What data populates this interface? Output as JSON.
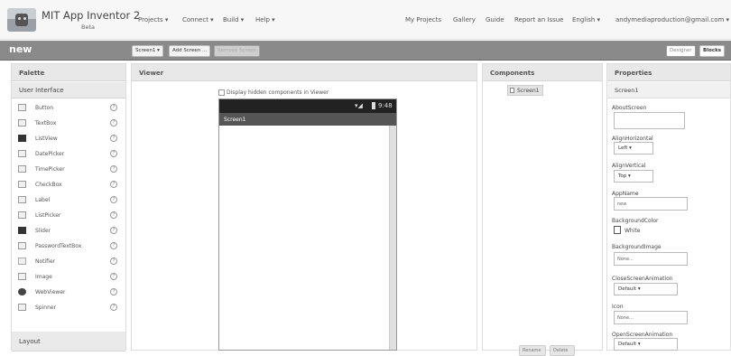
{
  "app": {
    "title": "MIT App Inventor 2",
    "badge": "Beta"
  },
  "nav": {
    "projects": "Projects ▾",
    "connect": "Connect ▾",
    "build": "Build ▾",
    "help": "Help ▾",
    "my_projects": "My Projects",
    "gallery": "Gallery",
    "guide": "Guide",
    "report": "Report an Issue",
    "language": "English ▾",
    "account": "andymediaproduction@gmail.com ▾"
  },
  "project_bar": {
    "name": "new",
    "screen_select": "Screen1 ▾",
    "add_screen": "Add Screen ...",
    "remove_screen": "Remove Screen",
    "designer": "Designer",
    "blocks": "Blocks"
  },
  "palette": {
    "title": "Palette",
    "category": "User Interface",
    "items": [
      {
        "label": "Button",
        "icon": "button-icon"
      },
      {
        "label": "TextBox",
        "icon": "textbox-icon"
      },
      {
        "label": "ListView",
        "icon": "listview-icon"
      },
      {
        "label": "DatePicker",
        "icon": "datepicker-icon"
      },
      {
        "label": "TimePicker",
        "icon": "timepicker-icon"
      },
      {
        "label": "CheckBox",
        "icon": "checkbox-icon"
      },
      {
        "label": "Label",
        "icon": "label-icon"
      },
      {
        "label": "ListPicker",
        "icon": "listpicker-icon"
      },
      {
        "label": "Slider",
        "icon": "slider-icon"
      },
      {
        "label": "PasswordTextBox",
        "icon": "password-icon"
      },
      {
        "label": "Notifier",
        "icon": "notifier-icon"
      },
      {
        "label": "Image",
        "icon": "image-icon"
      },
      {
        "label": "WebViewer",
        "icon": "webviewer-icon"
      },
      {
        "label": "Spinner",
        "icon": "spinner-icon"
      }
    ],
    "help_glyph": "?",
    "layout_category": "Layout"
  },
  "viewer": {
    "title": "Viewer",
    "hidden_checkbox": "Display hidden components in Viewer",
    "time": "9:48",
    "screen_title": "Screen1"
  },
  "components": {
    "title": "Components",
    "root": "Screen1",
    "rename": "Rename",
    "delete": "Delete"
  },
  "properties": {
    "title": "Properties",
    "component": "Screen1",
    "about_label": "AboutScreen",
    "align_h_label": "AlignHorizontal",
    "align_h_value": "Left ▾",
    "align_v_label": "AlignVertical",
    "align_v_value": "Top ▾",
    "appname_label": "AppName",
    "appname_value": "new",
    "bgcolor_label": "BackgroundColor",
    "bgcolor_value": "White",
    "bgimage_label": "BackgroundImage",
    "bgimage_value": "None...",
    "close_anim_label": "CloseScreenAnimation",
    "close_anim_value": "Default ▾",
    "icon_label": "Icon",
    "icon_value": "None...",
    "open_anim_label": "OpenScreenAnimation",
    "open_anim_value": "Default ▾"
  }
}
